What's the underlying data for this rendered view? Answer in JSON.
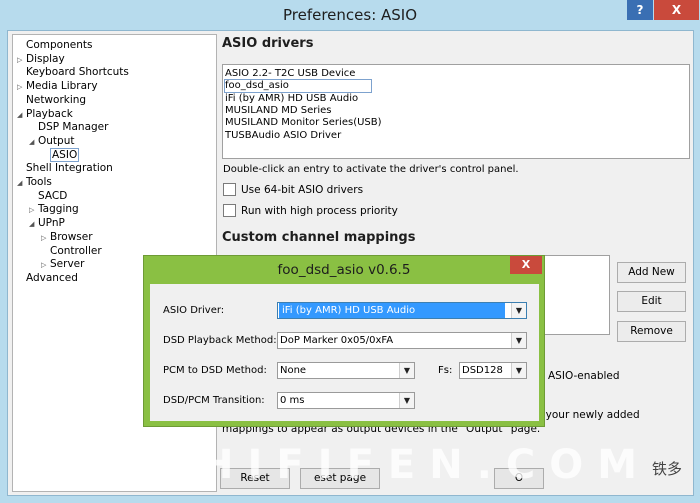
{
  "window": {
    "title": "Preferences: ASIO",
    "help_label": "?",
    "close_label": "X"
  },
  "tree": [
    {
      "label": "Components",
      "level": 0,
      "twisty": ""
    },
    {
      "label": "Display",
      "level": 0,
      "twisty": "▷"
    },
    {
      "label": "Keyboard Shortcuts",
      "level": 0,
      "twisty": ""
    },
    {
      "label": "Media Library",
      "level": 0,
      "twisty": "▷"
    },
    {
      "label": "Networking",
      "level": 0,
      "twisty": ""
    },
    {
      "label": "Playback",
      "level": 0,
      "twisty": "◢"
    },
    {
      "label": "DSP Manager",
      "level": 1,
      "twisty": ""
    },
    {
      "label": "Output",
      "level": 1,
      "twisty": "◢"
    },
    {
      "label": "ASIO",
      "level": 2,
      "twisty": "",
      "selected": true
    },
    {
      "label": "Shell Integration",
      "level": 0,
      "twisty": ""
    },
    {
      "label": "Tools",
      "level": 0,
      "twisty": "◢"
    },
    {
      "label": "SACD",
      "level": 1,
      "twisty": ""
    },
    {
      "label": "Tagging",
      "level": 1,
      "twisty": "▷"
    },
    {
      "label": "UPnP",
      "level": 1,
      "twisty": "◢"
    },
    {
      "label": "Browser",
      "level": 2,
      "twisty": "▷"
    },
    {
      "label": "Controller",
      "level": 2,
      "twisty": ""
    },
    {
      "label": "Server",
      "level": 2,
      "twisty": "▷"
    },
    {
      "label": "Advanced",
      "level": 0,
      "twisty": ""
    }
  ],
  "asio_drivers": {
    "heading": "ASIO drivers",
    "items": [
      {
        "label": "ASIO 2.2- T2C USB Device"
      },
      {
        "label": "foo_dsd_asio",
        "selected": true
      },
      {
        "label": "iFi (by AMR) HD USB Audio"
      },
      {
        "label": "MUSILAND MD Series"
      },
      {
        "label": "MUSILAND Monitor Series(USB)"
      },
      {
        "label": "TUSBAudio ASIO Driver"
      }
    ],
    "help_text": "Double-click an entry to activate the driver's control panel.",
    "use_64bit_label": "Use 64-bit ASIO drivers",
    "high_priority_label": "Run with high process priority"
  },
  "custom_mappings": {
    "heading": "Custom channel mappings",
    "add_new_label": "Add New",
    "edit_label": "Edit",
    "remove_label": "Remove",
    "partial_text_1": "ASIO-enabled",
    "partial_text_2": "r your newly added",
    "partial_text_3": "mappings to appear as output devices in the \"Output\" page."
  },
  "bottom": {
    "reset_all_label": "Reset",
    "reset_page_label": "eset page",
    "ok_label": "O",
    "watermark_text": "HIFIFEN.COM",
    "watermark_cn": "铁多"
  },
  "dialog": {
    "title": "foo_dsd_asio v0.6.5",
    "close_label": "X",
    "asio_driver_label": "ASIO Driver:",
    "asio_driver_value": "iFi (by AMR) HD USB Audio",
    "dsd_playback_label": "DSD Playback Method:",
    "dsd_playback_value": "DoP Marker 0x05/0xFA",
    "pcm_to_dsd_label": "PCM to DSD Method:",
    "pcm_to_dsd_value": "None",
    "fs_label": "Fs:",
    "fs_value": "DSD128",
    "transition_label": "DSD/PCM Transition:",
    "transition_value": "0 ms"
  }
}
